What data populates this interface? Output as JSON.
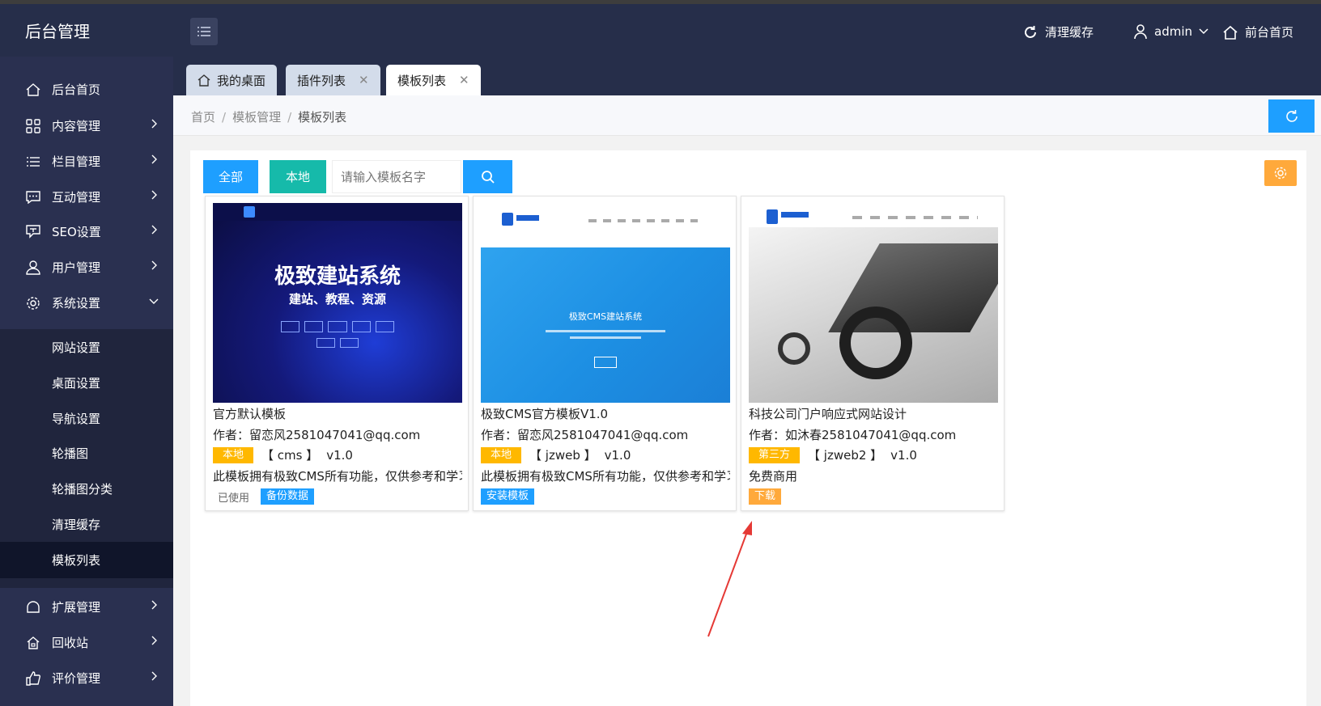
{
  "header": {
    "brand": "后台管理",
    "clear_cache": "清理缓存",
    "user": "admin",
    "front_home": "前台首页"
  },
  "sidebar": {
    "items": [
      {
        "label": "后台首页",
        "icon": "home-icon"
      },
      {
        "label": "内容管理",
        "icon": "grid-icon"
      },
      {
        "label": "栏目管理",
        "icon": "list-icon"
      },
      {
        "label": "互动管理",
        "icon": "chat-icon"
      },
      {
        "label": "SEO设置",
        "icon": "seo-icon"
      },
      {
        "label": "用户管理",
        "icon": "user-icon"
      },
      {
        "label": "系统设置",
        "icon": "settings-icon"
      },
      {
        "label": "扩展管理",
        "icon": "extension-icon"
      },
      {
        "label": "回收站",
        "icon": "recycle-icon"
      },
      {
        "label": "评价管理",
        "icon": "thumbs-up-icon"
      }
    ],
    "sub_items": [
      "网站设置",
      "桌面设置",
      "导航设置",
      "轮播图",
      "轮播图分类",
      "清理缓存",
      "模板列表"
    ]
  },
  "tabs": [
    {
      "label": "我的桌面",
      "closable": false
    },
    {
      "label": "插件列表",
      "closable": true
    },
    {
      "label": "模板列表",
      "closable": true,
      "active": true
    }
  ],
  "breadcrumb": [
    "首页",
    "模板管理",
    "模板列表"
  ],
  "toolbar": {
    "all_label": "全部",
    "local_label": "本地",
    "search_placeholder": "请输入模板名字"
  },
  "cards": [
    {
      "name": "官方默认模板",
      "author": "作者：留恋风2581047041@qq.com",
      "badge": "本地",
      "code": "【 cms 】",
      "version": "v1.0",
      "desc": "此模板拥有极致CMS所有功能，仅供参考和学习",
      "status": "已使用",
      "action": "备份数据",
      "thumb": {
        "heading": "极致建站系统",
        "sub": "建站、教程、资源"
      }
    },
    {
      "name": "极致CMS官方模板V1.0",
      "author": "作者：留恋风2581047041@qq.com",
      "badge": "本地",
      "code": "【 jzweb 】",
      "version": "v1.0",
      "desc": "此模板拥有极致CMS所有功能，仅供参考和学习",
      "action": "安装模板",
      "thumb": {
        "heading": "极致CMS建站系统"
      }
    },
    {
      "name": "科技公司门户响应式网站设计",
      "author": "作者：如沐春2581047041@qq.com",
      "badge": "第三方",
      "code": "【 jzweb2 】",
      "version": "v1.0",
      "desc": "免费商用",
      "action": "下载"
    }
  ],
  "colors": {
    "topbar": "#262e4a",
    "sidebar": "#2a3050",
    "blue": "#1e9fff",
    "teal": "#16baaa",
    "orange_badge": "#ffb800",
    "download_orange": "#ffa93b",
    "arrow": "#e53935"
  }
}
